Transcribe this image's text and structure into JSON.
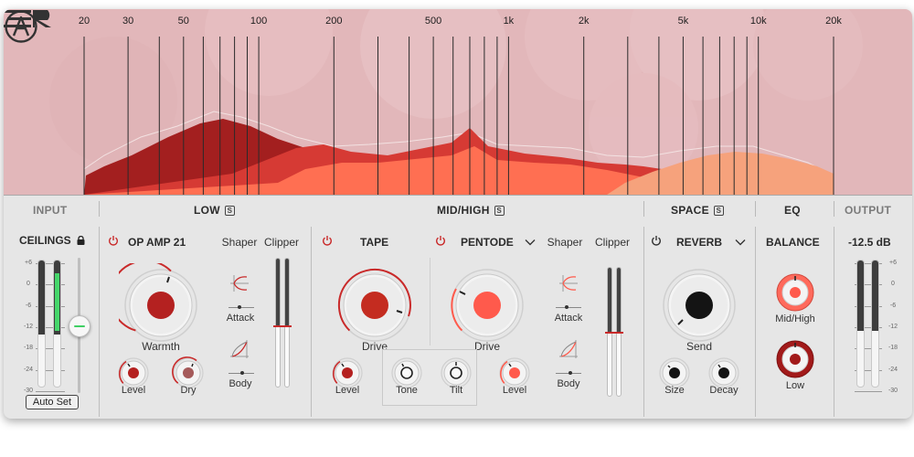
{
  "spectrum": {
    "freq_labels": [
      "20",
      "30",
      "50",
      "100",
      "200",
      "500",
      "1k",
      "2k",
      "5k",
      "10k",
      "20k"
    ]
  },
  "sections": {
    "input": "INPUT",
    "low": "LOW",
    "mid_high": "MID/HIGH",
    "space": "SPACE",
    "eq": "EQ",
    "output": "OUTPUT",
    "solo_glyph": "S"
  },
  "input_panel": {
    "ceilings": "CEILINGS",
    "scale": [
      "+6",
      "0",
      "-6",
      "-12",
      "-18",
      "-24",
      "-30"
    ],
    "auto_set": "Auto Set",
    "meter_left": 0.58,
    "meter_right": 0.58,
    "green_level": 0.55,
    "ceiling_level": 0.52
  },
  "low_panel": {
    "module": "OP AMP 21",
    "shaper": "Shaper",
    "clipper": "Clipper",
    "warmth": "Warmth",
    "level": "Level",
    "dry": "Dry",
    "attack": "Attack",
    "body": "Body",
    "clip_level": 0.52
  },
  "mid_panel": {
    "tape": "TAPE",
    "pentode": "PENTODE",
    "drive_a": "Drive",
    "drive_b": "Drive",
    "level_a": "Level",
    "tone": "Tone",
    "tilt": "Tilt",
    "level_b": "Level",
    "shaper": "Shaper",
    "clipper": "Clipper",
    "attack": "Attack",
    "body": "Body",
    "clip_level": 0.5
  },
  "space_panel": {
    "module": "REVERB",
    "send": "Send",
    "size": "Size",
    "decay": "Decay"
  },
  "eq_panel": {
    "title": "BALANCE",
    "mid_high": "Mid/High",
    "low": "Low"
  },
  "output_panel": {
    "value": "-12.5 dB",
    "scale": [
      "+6",
      "0",
      "-6",
      "-12",
      "-18",
      "-24",
      "-30"
    ],
    "meter_left": 0.55,
    "meter_right": 0.55
  },
  "colors": {
    "accent_red": "#c92a2a",
    "coral": "#ff5a4c",
    "spectrum_bg": "#e2b7ba"
  }
}
